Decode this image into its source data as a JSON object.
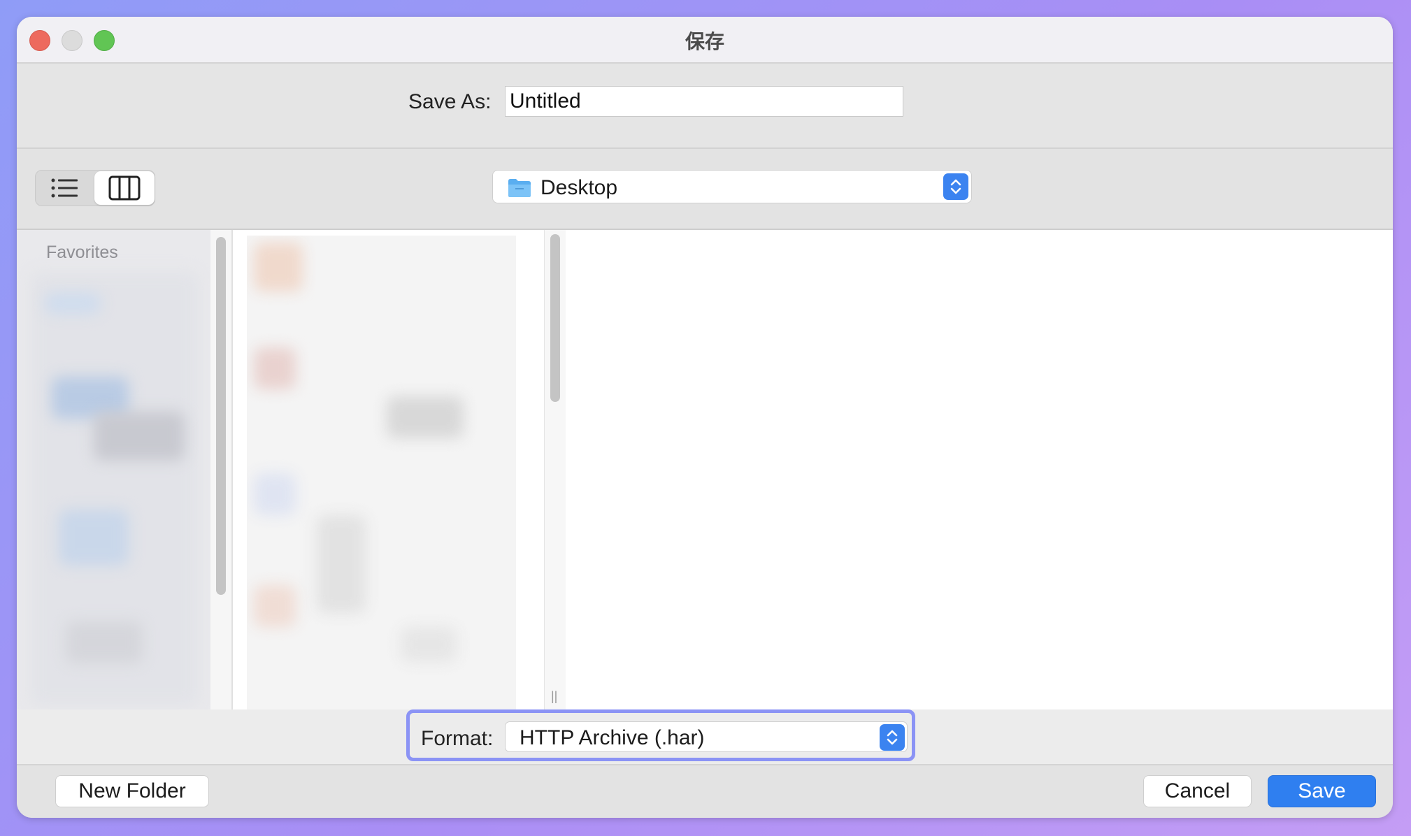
{
  "window": {
    "title": "保存"
  },
  "save_as": {
    "label": "Save As:",
    "value": "Untitled"
  },
  "toolbar": {
    "view_modes": [
      "list",
      "column"
    ],
    "selected_view": "column",
    "location": "Desktop"
  },
  "sidebar": {
    "section_label": "Favorites"
  },
  "format": {
    "label": "Format:",
    "value": "HTTP Archive (.har)"
  },
  "buttons": {
    "new_folder": "New Folder",
    "cancel": "Cancel",
    "save": "Save"
  },
  "colors": {
    "accent": "#2f7ff0",
    "focus_ring": "#8b93f5",
    "close": "#ed6a5e",
    "minimize": "#dcdcdc",
    "maximize": "#61c554"
  },
  "icons": {
    "list_view": "list-view-icon",
    "column_view": "column-view-icon",
    "folder": "folder-icon",
    "stepper": "up-down-chevron-icon"
  }
}
